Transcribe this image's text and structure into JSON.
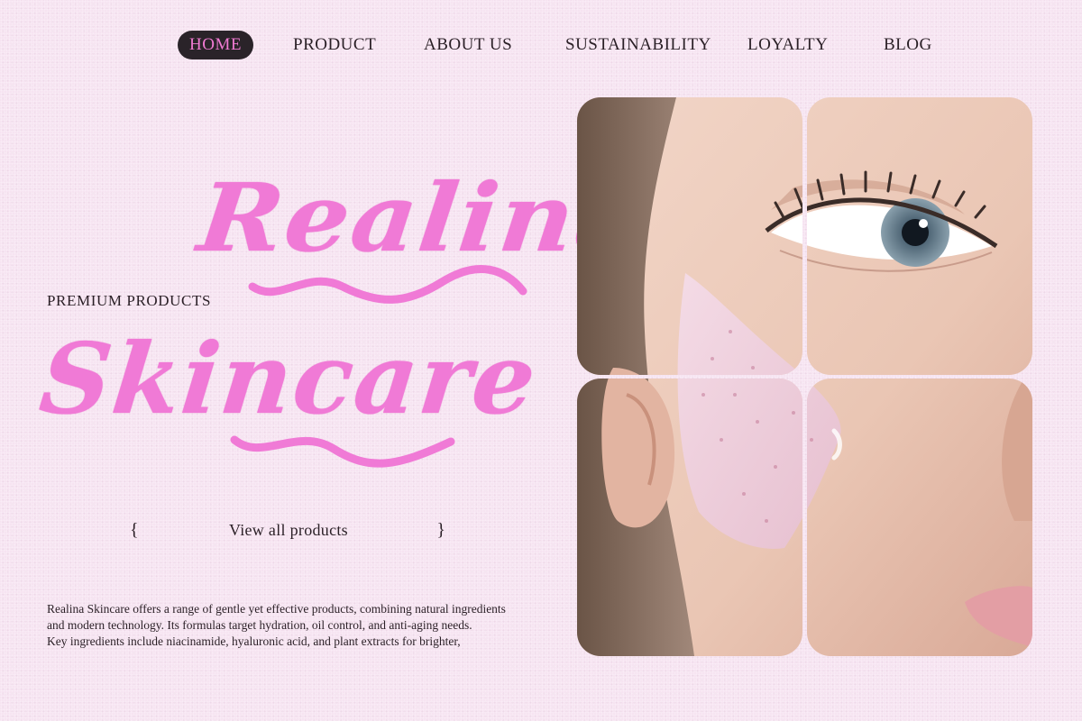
{
  "nav": {
    "items": [
      {
        "label": "HOME",
        "active": true
      },
      {
        "label": "PRODUCT",
        "active": false
      },
      {
        "label": "ABOUT US",
        "active": false
      },
      {
        "label": "SUSTAINABILITY",
        "active": false
      },
      {
        "label": "LOYALTY",
        "active": false
      },
      {
        "label": "BLOG",
        "active": false
      }
    ]
  },
  "hero": {
    "brand": "Realina",
    "product": "Skincare",
    "tagline": "PREMIUM PRODUCTS"
  },
  "cta": {
    "open_brace": "{",
    "label": "View all products",
    "close_brace": "}"
  },
  "description": {
    "lines": [
      "Realina Skincare offers a range of gentle yet effective products, combining natural ingredients",
      "and modern technology. Its formulas target hydration, oil control, and anti-aging needs.",
      "Key ingredients include niacinamide, hyaluronic acid, and plant extracts for brighter,"
    ]
  },
  "colors": {
    "background": "#f6e4f1",
    "accent_pink": "#f07ad6",
    "nav_active_bg": "#2a2329",
    "text": "#2a1f26"
  },
  "photo": {
    "subject": "close-up face with pink cream applied to cheek",
    "icon": "photo-face"
  }
}
